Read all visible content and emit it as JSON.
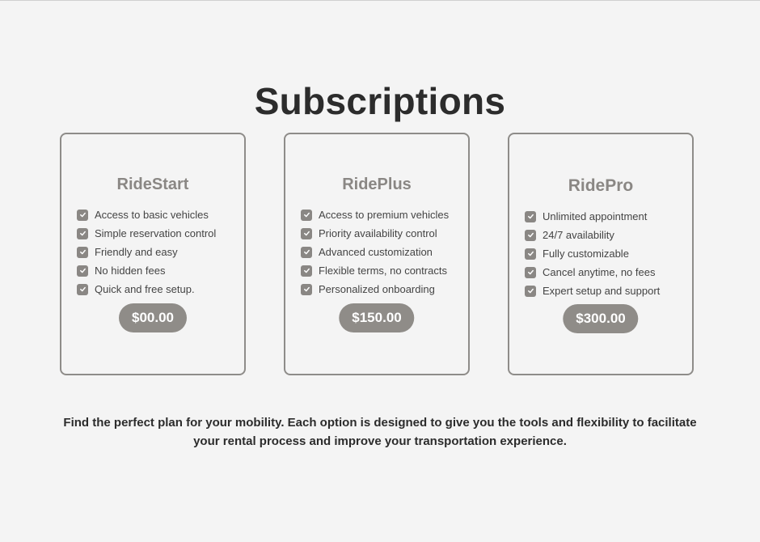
{
  "page": {
    "title": "Subscriptions",
    "description": "Find the perfect plan for your mobility. Each option is designed to give you the tools and flexibility to facilitate your rental process and improve your transportation experience."
  },
  "plans": [
    {
      "name": "RideStart",
      "features": [
        "Access to basic vehicles",
        "Simple reservation control",
        "Friendly and easy",
        "No hidden fees",
        "Quick and free setup."
      ],
      "price": "$00.00"
    },
    {
      "name": "RidePlus",
      "features": [
        "Access to premium vehicles",
        "Priority availability control",
        "Advanced customization",
        "Flexible terms, no contracts",
        "Personalized onboarding"
      ],
      "price": "$150.00"
    },
    {
      "name": "RidePro",
      "features": [
        "Unlimited appointment",
        "24/7 availability",
        "Fully customizable",
        "Cancel anytime, no fees",
        "Expert setup and support"
      ],
      "price": "$300.00"
    }
  ],
  "icons": {
    "feature_check": "checkbox-checked-icon"
  },
  "colors": {
    "background": "#f4f4f4",
    "accent": "#8f8c88",
    "text_dark": "#2c2c2c"
  }
}
